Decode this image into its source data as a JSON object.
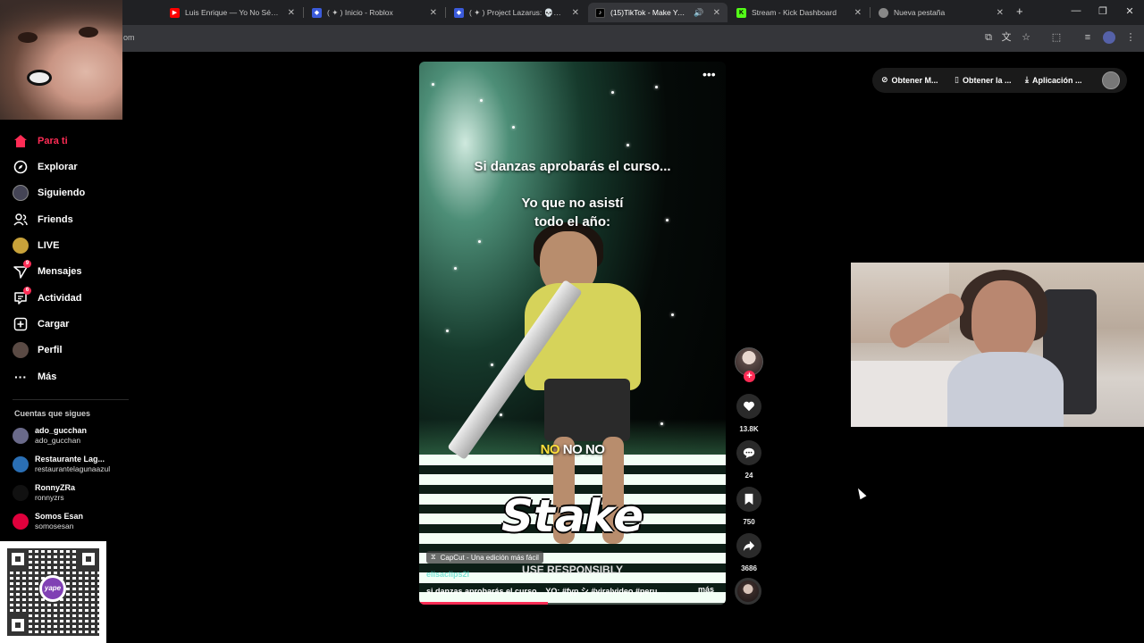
{
  "browser": {
    "tabs": [
      {
        "title": "Luis Enrique — Yo No Sé Mañana",
        "favicon": "youtube-icon",
        "color": "#ff0000"
      },
      {
        "title": "( ✦ ) Inicio - Roblox",
        "favicon": "roblox-icon",
        "color": "#3b5bdb"
      },
      {
        "title": "( ✦ ) Project Lazarus: 💀 ZOMBIES",
        "favicon": "roblox-icon",
        "color": "#3b5bdb"
      },
      {
        "title": "(15)TikTok - Make Your Day",
        "favicon": "tiktok-icon",
        "color": "#000000"
      },
      {
        "title": "Stream - Kick Dashboard",
        "favicon": "kick-icon",
        "color": "#53fc18"
      },
      {
        "title": "Nueva pestaña",
        "favicon": "chrome-icon",
        "color": "#888888"
      }
    ],
    "url_fragment": "om"
  },
  "sidebar": {
    "items": [
      {
        "label": "Para ti",
        "icon": "home-icon",
        "active": true
      },
      {
        "label": "Explorar",
        "icon": "compass-icon"
      },
      {
        "label": "Siguiendo",
        "icon": "following-avatar-icon"
      },
      {
        "label": "Friends",
        "icon": "friends-icon"
      },
      {
        "label": "LIVE",
        "icon": "live-icon"
      },
      {
        "label": "Mensajes",
        "icon": "send-icon",
        "badge": "9"
      },
      {
        "label": "Actividad",
        "icon": "activity-icon",
        "badge": "6"
      },
      {
        "label": "Cargar",
        "icon": "upload-icon"
      },
      {
        "label": "Perfil",
        "icon": "profile-avatar-icon"
      },
      {
        "label": "Más",
        "icon": "more-icon"
      }
    ],
    "following_title": "Cuentas que sigues",
    "following": [
      {
        "name": "ado_gucchan",
        "handle": "ado_gucchan",
        "color": "#6a6a8a"
      },
      {
        "name": "Restaurante Lag...",
        "handle": "restaurantelagunaazul",
        "color": "#2a6fb5"
      },
      {
        "name": "RonnyZRa",
        "handle": "ronnyzrs",
        "color": "#111111"
      },
      {
        "name": "Somos Esan",
        "handle": "somosesan",
        "color": "#e0003c"
      }
    ],
    "qr_logo": "yape"
  },
  "header": {
    "buttons": [
      "Obtener M...",
      "Obtener la ...",
      "Aplicación ..."
    ]
  },
  "video": {
    "caption_top": "Si danzas aprobarás el curso...",
    "caption_mid_1": "Yo que no asistí",
    "caption_mid_2": "todo el año:",
    "nono_1": "NO",
    "nono_2": " NO NO",
    "stake": "Stake",
    "use_responsibly": "USE RESPONSIBLY",
    "capcut": "CapCut - Una edición más fácil",
    "author": "elisaclips2l",
    "description": "si danzas aprobarás el curso... YO: #fyp シ #viralvideo #peru ...",
    "more": "más",
    "progress": 0.42
  },
  "actions": {
    "likes": "13.8K",
    "comments": "24",
    "saves": "750",
    "shares": "3686"
  }
}
